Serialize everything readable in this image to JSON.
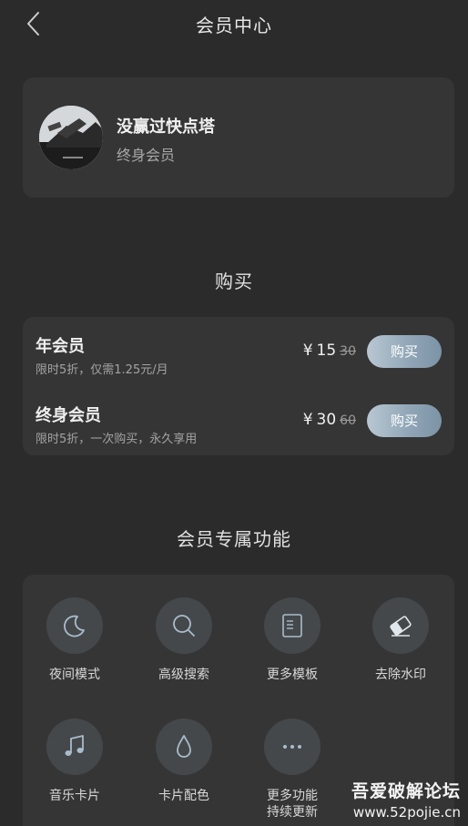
{
  "header": {
    "title": "会员中心",
    "back_icon": "chevron-left-icon"
  },
  "profile": {
    "name": "没赢过快点塔",
    "status": "终身会员"
  },
  "purchase": {
    "section_title": "购买",
    "plans": [
      {
        "name": "年会员",
        "desc": "限时5折，仅需1.25元/月",
        "currency": "¥",
        "price": "15",
        "original_price": "30",
        "button_label": "购买"
      },
      {
        "name": "终身会员",
        "desc": "限时5折，一次购买，永久享用",
        "currency": "¥",
        "price": "30",
        "original_price": "60",
        "button_label": "购买"
      }
    ],
    "button_color_start": "#b9c7d2",
    "button_color_end": "#7c93a6"
  },
  "features": {
    "section_title": "会员专属功能",
    "items": [
      {
        "label": "夜间模式",
        "icon": "moon-icon"
      },
      {
        "label": "高级搜索",
        "icon": "search-icon"
      },
      {
        "label": "更多模板",
        "icon": "template-icon"
      },
      {
        "label": "去除水印",
        "icon": "eraser-icon"
      },
      {
        "label": "音乐卡片",
        "icon": "music-note-icon"
      },
      {
        "label": "卡片配色",
        "icon": "droplet-icon"
      },
      {
        "label": "更多功能",
        "label2": "持续更新",
        "icon": "more-dots-icon"
      }
    ]
  },
  "watermark": {
    "title": "吾爱破解论坛",
    "url": "www.52pojie.cn"
  },
  "colors": {
    "background": "#2b2b2b",
    "card": "#353535",
    "icon_circle": "#45484b",
    "icon_stroke": "#a9bccb"
  }
}
